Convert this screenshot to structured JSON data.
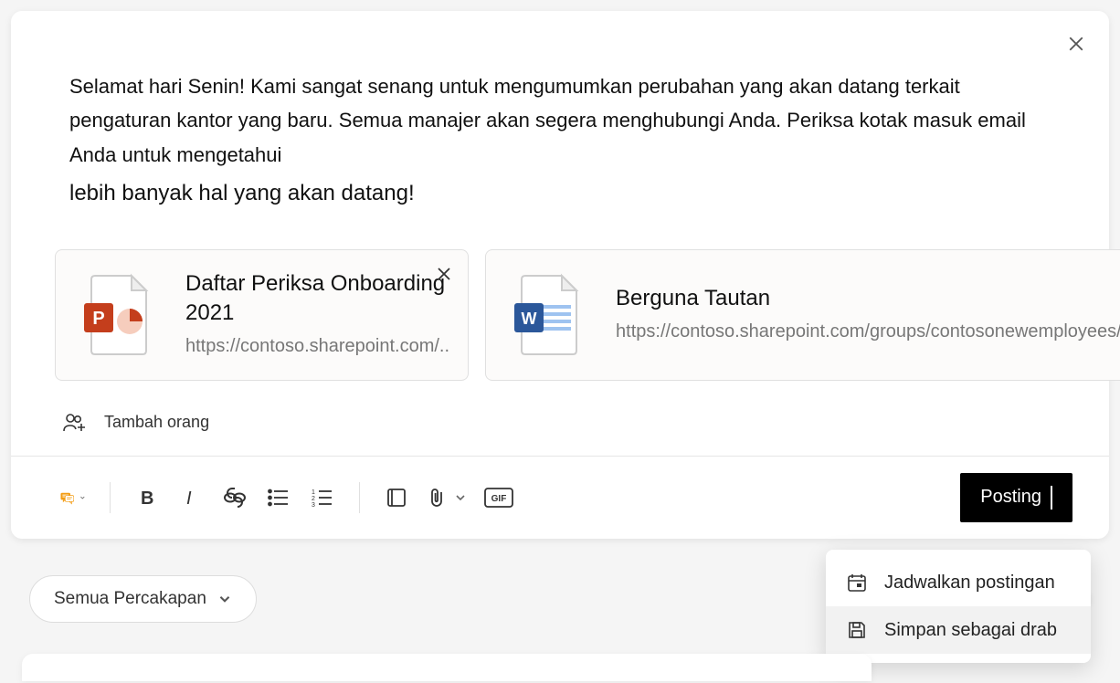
{
  "composer": {
    "message_line1": "Selamat hari Senin! Kami sangat senang untuk mengumumkan perubahan yang akan datang terkait pengaturan kantor yang baru. Semua manajer akan segera menghubungi Anda. Periksa kotak masuk email Anda untuk mengetahui",
    "message_line2": "lebih banyak hal yang akan datang!",
    "attachments": [
      {
        "title": "Daftar Periksa Onboarding 2021",
        "url": "https://contoso.sharepoint.com/..",
        "file_type": "powerpoint",
        "icon": "powerpoint-file-icon"
      },
      {
        "title": "Berguna  Tautan",
        "url": "https://contoso.sharepoint.com/groups/contosonewemployees/...",
        "file_type": "word",
        "icon": "word-file-icon"
      }
    ],
    "add_people_label": "Tambah orang"
  },
  "toolbar": {
    "post_type_icon": "discussion-icon",
    "buttons": {
      "bold": "bold-icon",
      "italic": "italic-icon",
      "link": "link-icon",
      "bulleted_list": "bulleted-list-icon",
      "numbered_list": "numbered-list-icon",
      "quote": "quote-icon",
      "attachment": "paperclip-icon",
      "gif": "gif-icon"
    },
    "post_label": "Posting"
  },
  "filter": {
    "label": "Semua Percakapan"
  },
  "dropdown": {
    "items": [
      {
        "icon": "calendar-icon",
        "label": "Jadwalkan postingan"
      },
      {
        "icon": "save-icon",
        "label": "Simpan sebagai drab"
      }
    ]
  },
  "icons": {
    "close": "close-icon",
    "add_people": "add-people-icon",
    "chevron_down": "chevron-down-icon",
    "check": "check-icon"
  },
  "colors": {
    "powerpoint": "#c43e1c",
    "word": "#2b579a",
    "post_button_bg": "#000000",
    "discussion_icon": "#f39c12"
  }
}
